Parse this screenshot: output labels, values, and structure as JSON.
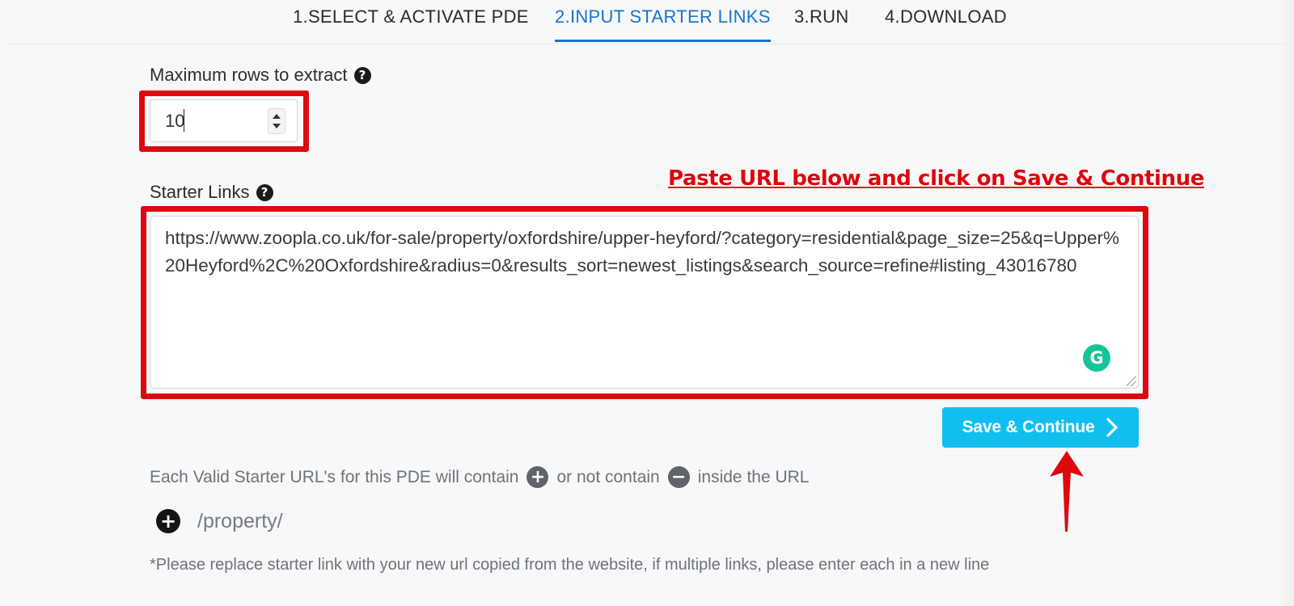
{
  "tabs": [
    {
      "label": "1.SELECT & ACTIVATE PDE",
      "active": false
    },
    {
      "label": "2.INPUT STARTER LINKS",
      "active": true
    },
    {
      "label": "3.RUN",
      "active": false
    },
    {
      "label": "4.DOWNLOAD",
      "active": false
    }
  ],
  "max_rows": {
    "label": "Maximum rows to extract",
    "value": "10"
  },
  "starter_links": {
    "label": "Starter Links",
    "value": "https://www.zoopla.co.uk/for-sale/property/oxfordshire/upper-heyford/?category=residential&page_size=25&q=Upper%20Heyford%2C%20Oxfordshire&radius=0&results_sort=newest_listings&search_source=refine#listing_43016780"
  },
  "annotation": "Paste URL below and click on Save & Continue",
  "save_button": {
    "label": "Save & Continue"
  },
  "validity": {
    "prefix": "Each Valid Starter URL's for this PDE will contain",
    "middle": "or not contain",
    "suffix": "inside the URL"
  },
  "rules": [
    {
      "type": "contain",
      "pattern": "/property/"
    }
  ],
  "footnote": "*Please replace starter link with your new url copied from the website, if multiple links, please enter each in a new line",
  "colors": {
    "active_tab": "#1a73c9",
    "highlight_red": "#dc0a10",
    "button_blue": "#10bff0",
    "grammarly_green": "#15c39a"
  },
  "icons": {
    "help": "question-circle-icon",
    "plus": "plus-circle-icon",
    "minus": "minus-circle-icon",
    "grammarly": "grammarly-icon",
    "chevron": "chevron-right-icon"
  }
}
